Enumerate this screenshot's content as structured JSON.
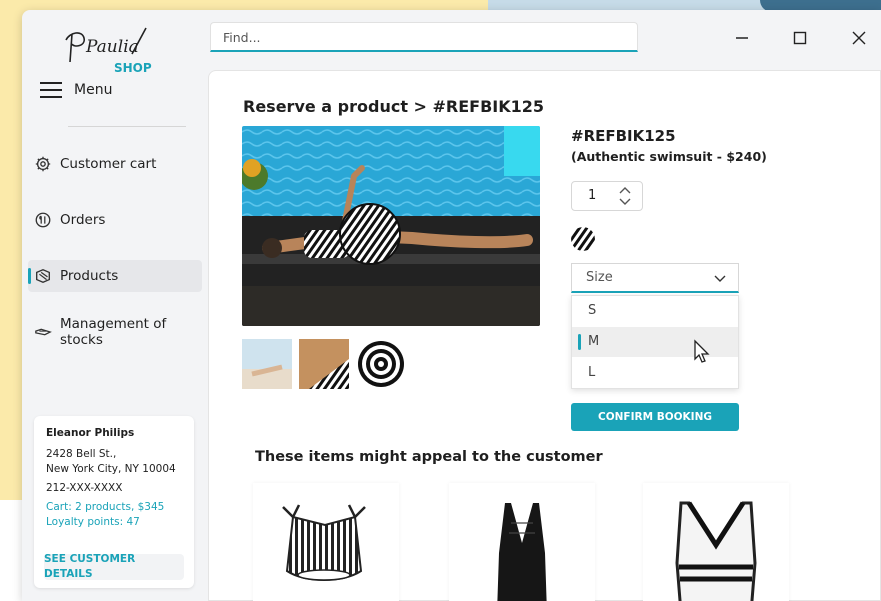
{
  "brand": {
    "logo_script": "Paulia",
    "logo_shop": "SHOP"
  },
  "search": {
    "placeholder": "Find..."
  },
  "window_controls": [
    "minimize",
    "maximize",
    "close"
  ],
  "sidebar": {
    "menu_label": "Menu",
    "items": [
      {
        "label": "Customer cart",
        "icon": "gear-icon",
        "active": false
      },
      {
        "label": "Orders",
        "icon": "orders-icon",
        "active": false
      },
      {
        "label": "Products",
        "icon": "products-icon",
        "active": true
      },
      {
        "label": "Management of stocks",
        "icon": "stocks-icon",
        "active": false
      }
    ]
  },
  "customer": {
    "name": "Eleanor Philips",
    "address_line1": "2428 Bell St.,",
    "address_line2": "New York City, NY 10004",
    "phone": "212-XXX-XXXX",
    "cart": "Cart: 2 products, $345",
    "loyalty": "Loyalty points: 47",
    "details_button": "SEE CUSTOMER DETAILS"
  },
  "page": {
    "title": "Reserve a product > #REFBIK125",
    "product_code": "#REFBIK125",
    "product_desc": "(Authentic swimsuit - $240)",
    "quantity": "1",
    "size_placeholder": "Size",
    "size_options": [
      "S",
      "M",
      "L"
    ],
    "size_selected": "M",
    "confirm_button": "CONFIRM BOOKING",
    "suggestions_title": "These items might appeal to the customer"
  },
  "colors": {
    "accent": "#1aa3b8",
    "pool": "#2aa7d6",
    "background_yellow": "#fbeaaa"
  }
}
